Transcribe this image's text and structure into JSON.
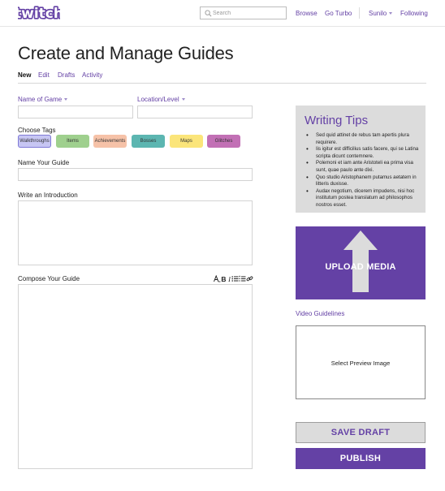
{
  "header": {
    "logo_text": "twitch",
    "search": {
      "placeholder": "Search"
    },
    "nav": {
      "browse": "Browse",
      "go_turbo": "Go Turbo",
      "user": "Sunilo",
      "following": "Following"
    }
  },
  "page": {
    "title": "Create and Manage Guides",
    "tabs": [
      {
        "label": "New",
        "active": true
      },
      {
        "label": "Edit",
        "active": false
      },
      {
        "label": "Drafts",
        "active": false
      },
      {
        "label": "Activity",
        "active": false
      }
    ]
  },
  "form": {
    "name_of_game": "Name of Game",
    "location_level": "Location/Level",
    "choose_tags": "Choose Tags",
    "tags": [
      {
        "label": "Walkthroughs",
        "color": "#c7c6f3",
        "selected": true
      },
      {
        "label": "Items",
        "color": "#9fd08e"
      },
      {
        "label": "Achievements",
        "color": "#f6c2a8"
      },
      {
        "label": "Bosses",
        "color": "#5cb6b1"
      },
      {
        "label": "Maps",
        "color": "#fbe57a"
      },
      {
        "label": "Glitches",
        "color": "#c270b5"
      }
    ],
    "name_your_guide": "Name Your Guide",
    "write_intro": "Write an Introduction",
    "compose_guide": "Compose Your Guide",
    "toolbar_icons": [
      "font-size-icon",
      "bold-icon",
      "italic-icon",
      "bullet-list-icon",
      "numbered-list-icon",
      "link-icon"
    ]
  },
  "sidebar": {
    "tips_title": "Writing Tips",
    "tips": [
      "Sed quid attinet de rebus tam apertis plura requirere.",
      "Iis igitur est difficilius satis facere, qui se Latina scripta  dicunt contemnere.",
      "Polemoni et iam ante Aristoteli ea prima visa sunt, quae paulo ante dixi.",
      "Quo studio Aristophanem putamus aetatem in litteris duxisse.",
      "Audax negotium, dicerem impudens, nisi hoc institutum postea translatum ad philosophos nostros esset."
    ],
    "upload_label": "UPLOAD MEDIA",
    "video_guidelines": "Video Guidelines",
    "preview_label": "Select Preview Image",
    "save_draft": "SAVE DRAFT",
    "publish": "PUBLISH"
  },
  "colors": {
    "brand": "#6441a5",
    "panel": "#dcdcdc",
    "border": "#d3d3d3"
  }
}
